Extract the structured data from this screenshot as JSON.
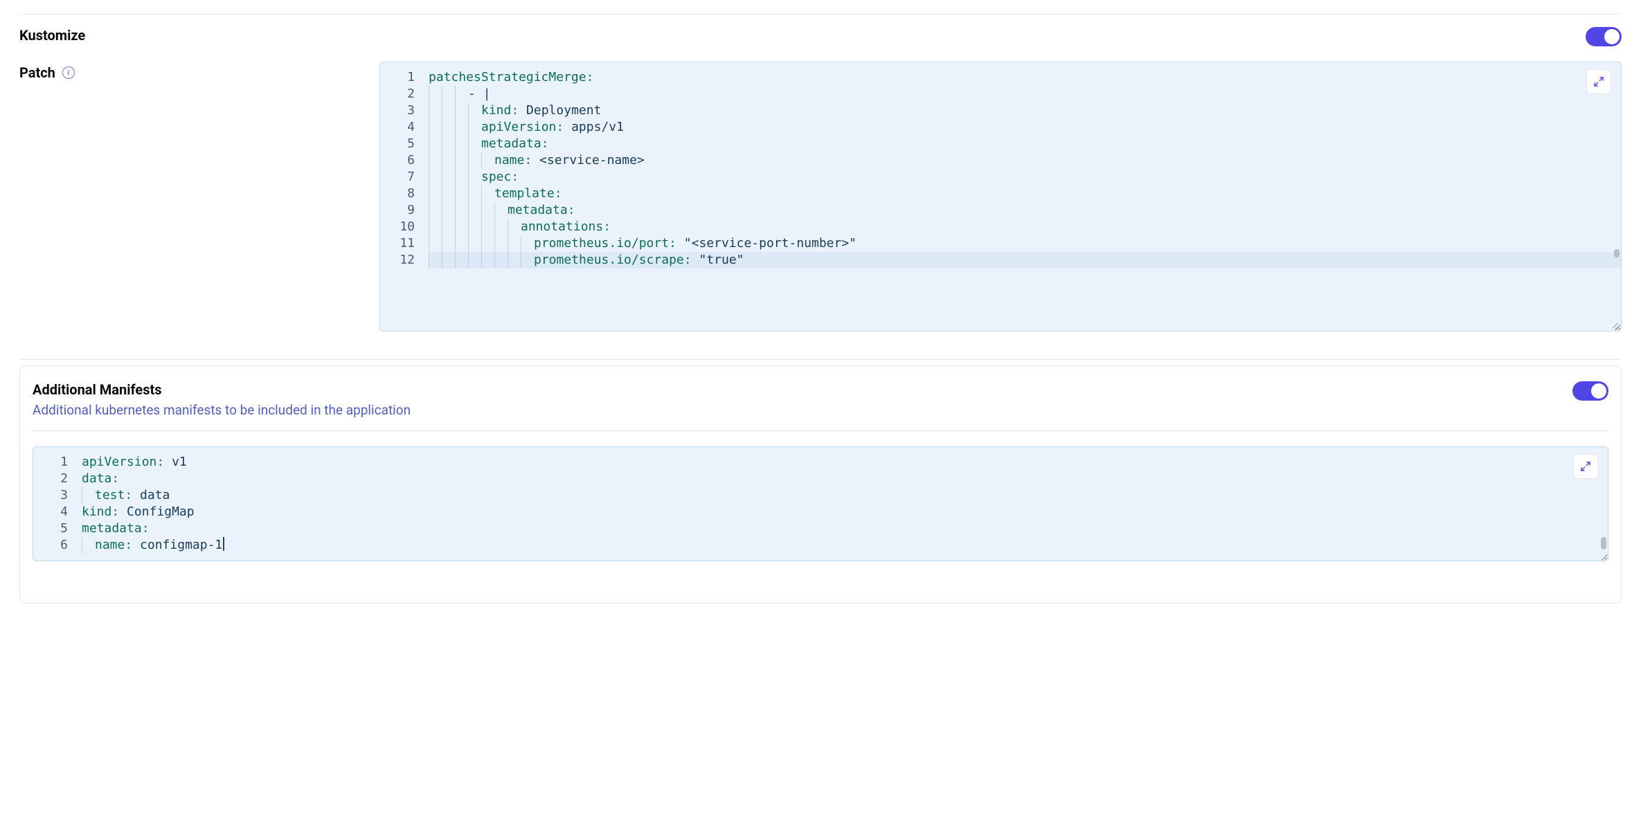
{
  "kustomize": {
    "title": "Kustomize",
    "toggle_on": true,
    "patch_label": "Patch",
    "editor": {
      "highlight_line": 12,
      "lines": [
        {
          "indent": 0,
          "segments": [
            {
              "t": "patchesStrategicMerge",
              "c": "key"
            },
            {
              "t": ":",
              "c": "punc"
            }
          ]
        },
        {
          "indent": 3,
          "segments": [
            {
              "t": "- ",
              "c": "dash"
            },
            {
              "t": "|",
              "c": "plain"
            }
          ]
        },
        {
          "indent": 4,
          "segments": [
            {
              "t": "kind",
              "c": "key"
            },
            {
              "t": ": ",
              "c": "punc"
            },
            {
              "t": "Deployment",
              "c": "plain"
            }
          ]
        },
        {
          "indent": 4,
          "segments": [
            {
              "t": "apiVersion",
              "c": "key"
            },
            {
              "t": ": ",
              "c": "punc"
            },
            {
              "t": "apps/v1",
              "c": "plain"
            }
          ]
        },
        {
          "indent": 4,
          "segments": [
            {
              "t": "metadata",
              "c": "key"
            },
            {
              "t": ":",
              "c": "punc"
            }
          ]
        },
        {
          "indent": 5,
          "segments": [
            {
              "t": "name",
              "c": "key"
            },
            {
              "t": ": ",
              "c": "punc"
            },
            {
              "t": "<service-name>",
              "c": "plain"
            }
          ]
        },
        {
          "indent": 4,
          "segments": [
            {
              "t": "spec",
              "c": "key"
            },
            {
              "t": ":",
              "c": "punc"
            }
          ]
        },
        {
          "indent": 5,
          "segments": [
            {
              "t": "template",
              "c": "key"
            },
            {
              "t": ":",
              "c": "punc"
            }
          ]
        },
        {
          "indent": 6,
          "segments": [
            {
              "t": "metadata",
              "c": "key"
            },
            {
              "t": ":",
              "c": "punc"
            }
          ]
        },
        {
          "indent": 7,
          "segments": [
            {
              "t": "annotations",
              "c": "key"
            },
            {
              "t": ":",
              "c": "punc"
            }
          ]
        },
        {
          "indent": 8,
          "segments": [
            {
              "t": "prometheus.io/port",
              "c": "key"
            },
            {
              "t": ": ",
              "c": "punc"
            },
            {
              "t": "\"<service-port-number>\"",
              "c": "str"
            }
          ]
        },
        {
          "indent": 8,
          "segments": [
            {
              "t": "prometheus.io/scrape",
              "c": "key"
            },
            {
              "t": ": ",
              "c": "punc"
            },
            {
              "t": "\"true\"",
              "c": "str"
            }
          ]
        }
      ]
    }
  },
  "manifests": {
    "title": "Additional Manifests",
    "subtitle": "Additional kubernetes manifests to be included in the application",
    "toggle_on": true,
    "editor": {
      "cursor_line": 6,
      "lines": [
        {
          "indent": 0,
          "segments": [
            {
              "t": "apiVersion",
              "c": "key"
            },
            {
              "t": ": ",
              "c": "punc"
            },
            {
              "t": "v1",
              "c": "plain"
            }
          ]
        },
        {
          "indent": 0,
          "segments": [
            {
              "t": "data",
              "c": "key"
            },
            {
              "t": ":",
              "c": "punc"
            }
          ]
        },
        {
          "indent": 1,
          "segments": [
            {
              "t": "test",
              "c": "key"
            },
            {
              "t": ": ",
              "c": "punc"
            },
            {
              "t": "data",
              "c": "plain"
            }
          ]
        },
        {
          "indent": 0,
          "segments": [
            {
              "t": "kind",
              "c": "key"
            },
            {
              "t": ": ",
              "c": "punc"
            },
            {
              "t": "ConfigMap",
              "c": "plain"
            }
          ]
        },
        {
          "indent": 0,
          "segments": [
            {
              "t": "metadata",
              "c": "key"
            },
            {
              "t": ":",
              "c": "punc"
            }
          ]
        },
        {
          "indent": 1,
          "segments": [
            {
              "t": "name",
              "c": "key"
            },
            {
              "t": ": ",
              "c": "punc"
            },
            {
              "t": "configmap-1",
              "c": "plain"
            }
          ]
        }
      ]
    }
  }
}
